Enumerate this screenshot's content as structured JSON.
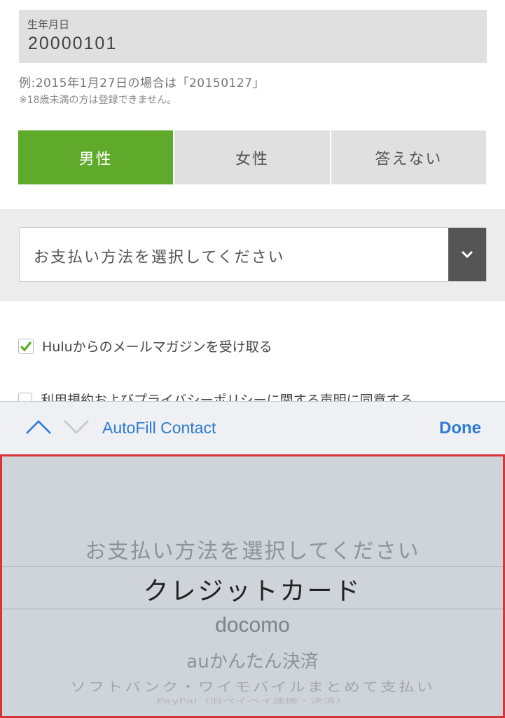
{
  "form": {
    "dob": {
      "label": "生年月日",
      "value": "20000101"
    },
    "hint_example": "例:2015年1月27日の場合は「20150127」",
    "hint_age": "※18歳未満の方は登録できません。",
    "gender": {
      "options": [
        "男性",
        "女性",
        "答えない"
      ],
      "selected": "男性"
    },
    "payment": {
      "placeholder": "お支払い方法を選択してください"
    },
    "checkboxes": [
      {
        "label": "Huluからのメールマガジンを受け取る",
        "checked": true
      },
      {
        "label": "利用規約およびプライバシーポリシーに関する声明に同意する",
        "checked": false
      }
    ]
  },
  "toolbar": {
    "prev_icon": "chevron-up-icon",
    "next_icon": "chevron-down-icon",
    "autofill_label": "AutoFill Contact",
    "done_label": "Done"
  },
  "picker": {
    "items": [
      "お支払い方法を選択してください",
      "クレジットカード",
      "docomo",
      "auかんたん決済",
      "ソフトバンク・ワイモバイルまとめて支払い",
      "PayPal（旧ペイペイ連携・決済）"
    ],
    "selected": "クレジットカード"
  },
  "colors": {
    "accent_green": "#5fa92b",
    "ios_blue": "#2d7bd1",
    "highlight_border": "#d9333a"
  }
}
